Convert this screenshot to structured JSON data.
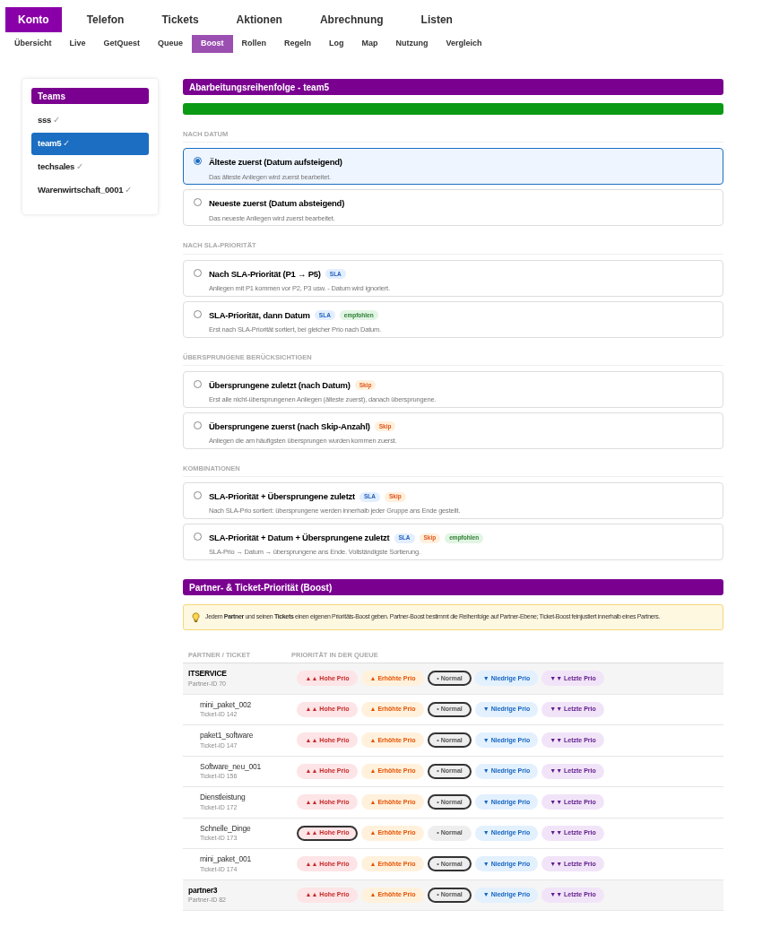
{
  "main_nav": [
    {
      "label": "Konto",
      "selected": true
    },
    {
      "label": "Telefon",
      "selected": false
    },
    {
      "label": "Tickets",
      "selected": false
    },
    {
      "label": "Aktionen",
      "selected": false
    },
    {
      "label": "Abrechnung",
      "selected": false
    },
    {
      "label": "Listen",
      "selected": false
    }
  ],
  "sub_nav": [
    {
      "label": "Übersicht",
      "selected": false
    },
    {
      "label": "Live",
      "selected": false
    },
    {
      "label": "GetQuest",
      "selected": false
    },
    {
      "label": "Queue",
      "selected": false
    },
    {
      "label": "Boost",
      "selected": true
    },
    {
      "label": "Rollen",
      "selected": false
    },
    {
      "label": "Regeln",
      "selected": false
    },
    {
      "label": "Log",
      "selected": false
    },
    {
      "label": "Map",
      "selected": false
    },
    {
      "label": "Nutzung",
      "selected": false
    },
    {
      "label": "Vergleich",
      "selected": false
    }
  ],
  "sidebar": {
    "title": "Teams",
    "items": [
      {
        "label": "sss",
        "check": "✓",
        "selected": false
      },
      {
        "label": "team5",
        "check": "✓",
        "selected": true
      },
      {
        "label": "techsales",
        "check": "✓",
        "selected": false
      },
      {
        "label": "Warenwirtschaft_0001",
        "check": "✓",
        "selected": false
      }
    ]
  },
  "order": {
    "title": "Abarbeitungsreihenfolge - team5",
    "groups": [
      {
        "label": "NACH DATUM",
        "options": [
          {
            "title": "Älteste zuerst (Datum aufsteigend)",
            "description": "Das älteste Anliegen wird zuerst bearbeitet.",
            "selected": true
          },
          {
            "title": "Neueste zuerst (Datum absteigend)",
            "description": "Das neueste Anliegen wird zuerst bearbeitet.",
            "selected": false
          }
        ]
      },
      {
        "label": "NACH SLA-PRIORITÄT",
        "options": [
          {
            "title": "Nach SLA-Priorität (P1 → P5)",
            "description": "Anliegen mit P1 kommen vor P2, P3 usw. - Datum wird ignoriert.",
            "selected": false,
            "badges": [
              {
                "kind": "sla",
                "label": "SLA"
              }
            ]
          },
          {
            "title": "SLA-Priorität, dann Datum",
            "description": "Erst nach SLA-Priorität sortiert, bei gleicher Prio nach Datum.",
            "selected": false,
            "badges": [
              {
                "kind": "sla",
                "label": "SLA"
              },
              {
                "kind": "recommended",
                "label": "empfohlen"
              }
            ]
          }
        ]
      },
      {
        "label": "ÜBERSPRUNGENE BERÜCKSICHTIGEN",
        "options": [
          {
            "title": "Übersprungene zuletzt (nach Datum)",
            "description": "Erst alle nicht-übersprungenen Anliegen (älteste zuerst), danach übersprungene.",
            "selected": false,
            "badges": [
              {
                "kind": "skip",
                "label": "Skip"
              }
            ]
          },
          {
            "title": "Übersprungene zuerst (nach Skip-Anzahl)",
            "description": "Anliegen die am häufigsten übersprungen wurden kommen zuerst.",
            "selected": false,
            "badges": [
              {
                "kind": "skip",
                "label": "Skip"
              }
            ]
          }
        ]
      },
      {
        "label": "KOMBINATIONEN",
        "options": [
          {
            "title": "SLA-Priorität + Übersprungene zuletzt",
            "description": "Nach SLA-Prio sortiert: übersprungene werden innerhalb jeder Gruppe ans Ende gestellt.",
            "selected": false,
            "badges": [
              {
                "kind": "sla",
                "label": "SLA"
              },
              {
                "kind": "skip",
                "label": "Skip"
              }
            ]
          },
          {
            "title": "SLA-Priorität + Datum + Übersprungene zuletzt",
            "description": "SLA-Prio → Datum → übersprungene ans Ende. Vollständigste Sortierung.",
            "selected": false,
            "badges": [
              {
                "kind": "sla",
                "label": "SLA"
              },
              {
                "kind": "skip",
                "label": "Skip"
              },
              {
                "kind": "recommended",
                "label": "empfohlen"
              }
            ]
          }
        ]
      }
    ]
  },
  "boost": {
    "title": "Partner- & Ticket-Priorität (Boost)",
    "hint": "Jedem **Partner** und seinen **Tickets** einen eigenen Prioritäts-Boost geben. Partner-Boost bestimmt die Reihenfolge auf Partner-Ebene; Ticket-Boost feinjustiert innerhalb eines Partners.",
    "columns": [
      "PARTNER / TICKET",
      "PRIORITÄT IN DER QUEUE"
    ],
    "rows": [
      {
        "kind": "partner",
        "name": "ITSERVICE",
        "id": "Partner-ID 70",
        "options": [
          {
            "kind": "high",
            "label": "▲▲ Hohe Prio",
            "selected": false
          },
          {
            "kind": "raised",
            "label": "▲ Erhöhte Prio",
            "selected": false
          },
          {
            "kind": "normal",
            "label": "• Normal",
            "selected": true
          },
          {
            "kind": "low",
            "label": "▼ Niedrige Prio",
            "selected": false
          },
          {
            "kind": "last",
            "label": "▼▼ Letzte Prio",
            "selected": false
          }
        ]
      },
      {
        "kind": "ticket",
        "name": "mini_paket_002",
        "id": "Ticket-ID 142",
        "options": [
          {
            "kind": "high",
            "label": "▲▲ Hohe Prio",
            "selected": false
          },
          {
            "kind": "raised",
            "label": "▲ Erhöhte Prio",
            "selected": false
          },
          {
            "kind": "normal",
            "label": "• Normal",
            "selected": true
          },
          {
            "kind": "low",
            "label": "▼ Niedrige Prio",
            "selected": false
          },
          {
            "kind": "last",
            "label": "▼▼ Letzte Prio",
            "selected": false
          }
        ]
      },
      {
        "kind": "ticket",
        "name": "paket1_software",
        "id": "Ticket-ID 147",
        "options": [
          {
            "kind": "high",
            "label": "▲▲ Hohe Prio",
            "selected": false
          },
          {
            "kind": "raised",
            "label": "▲ Erhöhte Prio",
            "selected": false
          },
          {
            "kind": "normal",
            "label": "• Normal",
            "selected": true
          },
          {
            "kind": "low",
            "label": "▼ Niedrige Prio",
            "selected": false
          },
          {
            "kind": "last",
            "label": "▼▼ Letzte Prio",
            "selected": false
          }
        ]
      },
      {
        "kind": "ticket",
        "name": "Software_neu_001",
        "id": "Ticket-ID 156",
        "options": [
          {
            "kind": "high",
            "label": "▲▲ Hohe Prio",
            "selected": false
          },
          {
            "kind": "raised",
            "label": "▲ Erhöhte Prio",
            "selected": false
          },
          {
            "kind": "normal",
            "label": "• Normal",
            "selected": true
          },
          {
            "kind": "low",
            "label": "▼ Niedrige Prio",
            "selected": false
          },
          {
            "kind": "last",
            "label": "▼▼ Letzte Prio",
            "selected": false
          }
        ]
      },
      {
        "kind": "ticket",
        "name": "Dienstleistung",
        "id": "Ticket-ID 172",
        "options": [
          {
            "kind": "high",
            "label": "▲▲ Hohe Prio",
            "selected": false
          },
          {
            "kind": "raised",
            "label": "▲ Erhöhte Prio",
            "selected": false
          },
          {
            "kind": "normal",
            "label": "• Normal",
            "selected": true
          },
          {
            "kind": "low",
            "label": "▼ Niedrige Prio",
            "selected": false
          },
          {
            "kind": "last",
            "label": "▼▼ Letzte Prio",
            "selected": false
          }
        ]
      },
      {
        "kind": "ticket",
        "name": "Schnelle_Dinge",
        "id": "Ticket-ID 173",
        "options": [
          {
            "kind": "high",
            "label": "▲▲ Hohe Prio",
            "selected": true
          },
          {
            "kind": "raised",
            "label": "▲ Erhöhte Prio",
            "selected": false
          },
          {
            "kind": "normal",
            "label": "• Normal",
            "selected": false
          },
          {
            "kind": "low",
            "label": "▼ Niedrige Prio",
            "selected": false
          },
          {
            "kind": "last",
            "label": "▼▼ Letzte Prio",
            "selected": false
          }
        ]
      },
      {
        "kind": "ticket",
        "name": "mini_paket_001",
        "id": "Ticket-ID 174",
        "options": [
          {
            "kind": "high",
            "label": "▲▲ Hohe Prio",
            "selected": false
          },
          {
            "kind": "raised",
            "label": "▲ Erhöhte Prio",
            "selected": false
          },
          {
            "kind": "normal",
            "label": "• Normal",
            "selected": true
          },
          {
            "kind": "low",
            "label": "▼ Niedrige Prio",
            "selected": false
          },
          {
            "kind": "last",
            "label": "▼▼ Letzte Prio",
            "selected": false
          }
        ]
      },
      {
        "kind": "partner",
        "name": "partner3",
        "id": "Partner-ID 82",
        "options": [
          {
            "kind": "high",
            "label": "▲▲ Hohe Prio",
            "selected": false
          },
          {
            "kind": "raised",
            "label": "▲ Erhöhte Prio",
            "selected": false
          },
          {
            "kind": "normal",
            "label": "• Normal",
            "selected": true
          },
          {
            "kind": "low",
            "label": "▼ Niedrige Prio",
            "selected": false
          },
          {
            "kind": "last",
            "label": "▼▼ Letzte Prio",
            "selected": false
          }
        ]
      }
    ]
  }
}
